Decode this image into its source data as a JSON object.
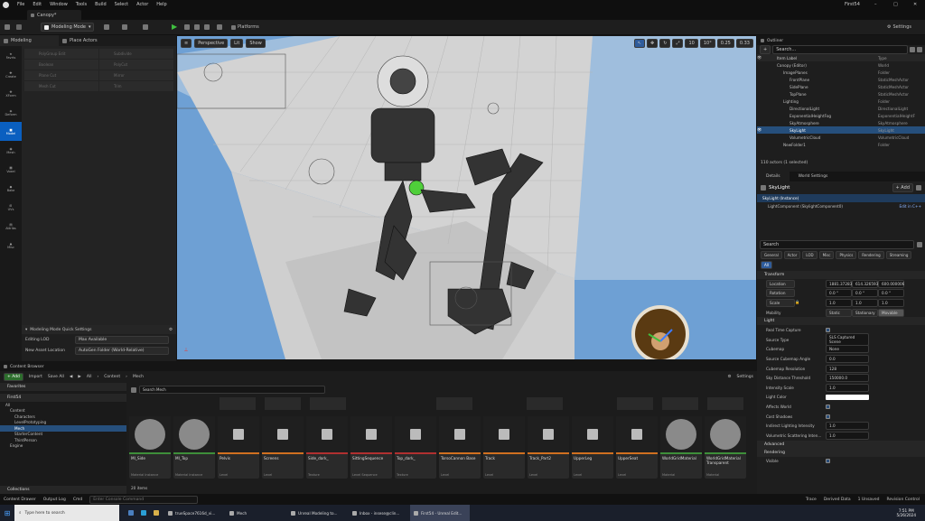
{
  "window": {
    "title": "First54",
    "project_tab": "Canopy*",
    "buttons": [
      "–",
      "□",
      "✕"
    ]
  },
  "menu": [
    "File",
    "Edit",
    "Window",
    "Tools",
    "Build",
    "Select",
    "Actor",
    "Help"
  ],
  "toolbar": {
    "save_icon": "save-icon",
    "mode": "Modeling Mode",
    "platforms": "Platforms",
    "settings": "Settings"
  },
  "modes": {
    "tab1": "Modeling",
    "tab2": "Place Actors"
  },
  "rail": [
    "Favrts",
    "Create",
    "XForm",
    "Deform",
    "Model",
    "Mesh",
    "Voxel",
    "Bake",
    "UVs",
    "Attribs",
    "Misc"
  ],
  "tools": [
    "PolyGroup Edit",
    "Subdivide",
    "Boolean",
    "PolyCut",
    "Plane Cut",
    "Mirror",
    "Mesh Cut",
    "Trim"
  ],
  "quick": {
    "title": "Modeling Mode Quick Settings",
    "lod_label": "Editing LOD",
    "lod_value": "Max Available",
    "path_label": "New Asset Location",
    "path_value": "AutoGen Folder (World-Relative)"
  },
  "viewport": {
    "perspective": "Perspective",
    "lit": "Lit",
    "show": "Show",
    "fov": "10",
    "angle": "10°",
    "scale": "0.25",
    "speed": "0.33"
  },
  "outliner": {
    "title": "Outliner",
    "search": "Search...",
    "col_label": "Item Label",
    "col_type": "Type",
    "rows": [
      {
        "label": "Canopy (Editor)",
        "type": "World",
        "indent": 0
      },
      {
        "label": "ImagePlanes",
        "type": "Folder",
        "indent": 1
      },
      {
        "label": "FrontPlane",
        "type": "StaticMeshActor",
        "indent": 2
      },
      {
        "label": "SidePlane",
        "type": "StaticMeshActor",
        "indent": 2
      },
      {
        "label": "TopPlane",
        "type": "StaticMeshActor",
        "indent": 2
      },
      {
        "label": "Lighting",
        "type": "Folder",
        "indent": 1
      },
      {
        "label": "DirectionalLight",
        "type": "DirectionalLight",
        "indent": 2
      },
      {
        "label": "ExponentialHeightFog",
        "type": "ExponentialHeightF",
        "indent": 2
      },
      {
        "label": "SkyAtmosphere",
        "type": "SkyAtmosphere",
        "indent": 2
      },
      {
        "label": "SkyLight",
        "type": "SkyLight",
        "indent": 2,
        "selected": true
      },
      {
        "label": "VolumetricCloud",
        "type": "VolumetricCloud",
        "indent": 2
      },
      {
        "label": "NewFolder1",
        "type": "Folder",
        "indent": 1
      }
    ],
    "footer": "110 actors (1 selected)"
  },
  "details": {
    "tab1": "Details",
    "tab2": "World Settings",
    "actor": "SkyLight",
    "add": "+ Add",
    "instance": "SkyLight (Instance)",
    "component": "LightComponent (SkylightComponent0)",
    "edit_cpp": "Edit in C++",
    "search": "Search",
    "filters": [
      "General",
      "Actor",
      "LOD",
      "Misc",
      "Physics",
      "Rendering",
      "Streaming",
      "All"
    ],
    "transform": "Transform",
    "location": {
      "label": "Location",
      "x": "1881.37283",
      "y": "614.326593",
      "z": "600.000006"
    },
    "rotation": {
      "label": "Rotation",
      "x": "0.0 °",
      "y": "0.0 °",
      "z": "0.0 °"
    },
    "scale": {
      "label": "Scale",
      "x": "1.0",
      "y": "1.0",
      "z": "1.0"
    },
    "mobility": {
      "label": "Mobility",
      "opts": [
        "Static",
        "Stationary",
        "Movable"
      ]
    },
    "light": "Light",
    "props": [
      {
        "label": "Real Time Capture",
        "value": "check"
      },
      {
        "label": "Source Type",
        "value": "SLS Captured Scene"
      },
      {
        "label": "Cubemap",
        "value": "None"
      },
      {
        "label": "Source Cubemap Angle",
        "value": "0.0"
      },
      {
        "label": "Cubemap Resolution",
        "value": "128"
      },
      {
        "label": "Sky Distance Threshold",
        "value": "150000.0"
      },
      {
        "label": "Intensity Scale",
        "value": "1.0"
      },
      {
        "label": "Light Color",
        "value": "color"
      },
      {
        "label": "Affects World",
        "value": "check"
      },
      {
        "label": "Cast Shadows",
        "value": "check"
      },
      {
        "label": "Indirect Lighting Intensity",
        "value": "1.0"
      },
      {
        "label": "Volumetric Scattering Inten...",
        "value": "1.0"
      }
    ],
    "advanced": "Advanced",
    "rendering": "Rendering",
    "visible": "Visible"
  },
  "content": {
    "tab": "Content Browser",
    "add": "+ Add",
    "import": "Import",
    "save_all": "Save All",
    "path": [
      "All",
      "Content",
      "Mech"
    ],
    "settings": "Settings",
    "favorites": "Favorites",
    "project": "First54",
    "search": "Search Mech",
    "tree": [
      "All",
      "Content",
      "Characters",
      "LevelPrototyping",
      "Mech",
      "StarterContent",
      "ThirdPerson",
      "Engine"
    ],
    "collections": "Collections",
    "count": "20 items",
    "assets": [
      {
        "name": "MI_Side",
        "type": "Material Instance",
        "color": "#3e8e3a"
      },
      {
        "name": "MI_Top",
        "type": "Material Instance",
        "color": "#3e8e3a"
      },
      {
        "name": "Pelvis",
        "type": "Level",
        "color": "#d07020"
      },
      {
        "name": "Screens",
        "type": "Level",
        "color": "#d07020"
      },
      {
        "name": "Side_dark_",
        "type": "Texture",
        "color": "#b03030"
      },
      {
        "name": "SittingSequence",
        "type": "Level Sequence",
        "color": "#b03030"
      },
      {
        "name": "Top_dark_",
        "type": "Texture",
        "color": "#b03030"
      },
      {
        "name": "TorsoCannon Base",
        "type": "Level",
        "color": "#d07020"
      },
      {
        "name": "Track",
        "type": "Level",
        "color": "#d07020"
      },
      {
        "name": "Track_Part2",
        "type": "Level",
        "color": "#d07020"
      },
      {
        "name": "UpperLeg",
        "type": "Level",
        "color": "#d07020"
      },
      {
        "name": "UpperSeat",
        "type": "Level",
        "color": "#d07020"
      },
      {
        "name": "WorldGridMaterial",
        "type": "Material",
        "color": "#3e8e3a"
      },
      {
        "name": "WorldGridMaterial Transparent",
        "type": "Material",
        "color": "#3e8e3a"
      }
    ]
  },
  "status": {
    "drawer": "Content Drawer",
    "log": "Output Log",
    "cmd": "Cmd",
    "cmd_placeholder": "Enter Console Command",
    "trace": "Trace",
    "derived": "Derived Data",
    "unsaved": "1 Unsaved",
    "revision": "Revision Control"
  },
  "taskbar": {
    "search": "Type here to search",
    "apps": [
      "trueSpace7616d_vi...",
      "Mech",
      "Unreal Modeling to...",
      "Inbox - insese@clin...",
      "First54 - Unreal Edit..."
    ],
    "time": "7:51 PM",
    "date": "5/26/2024"
  }
}
